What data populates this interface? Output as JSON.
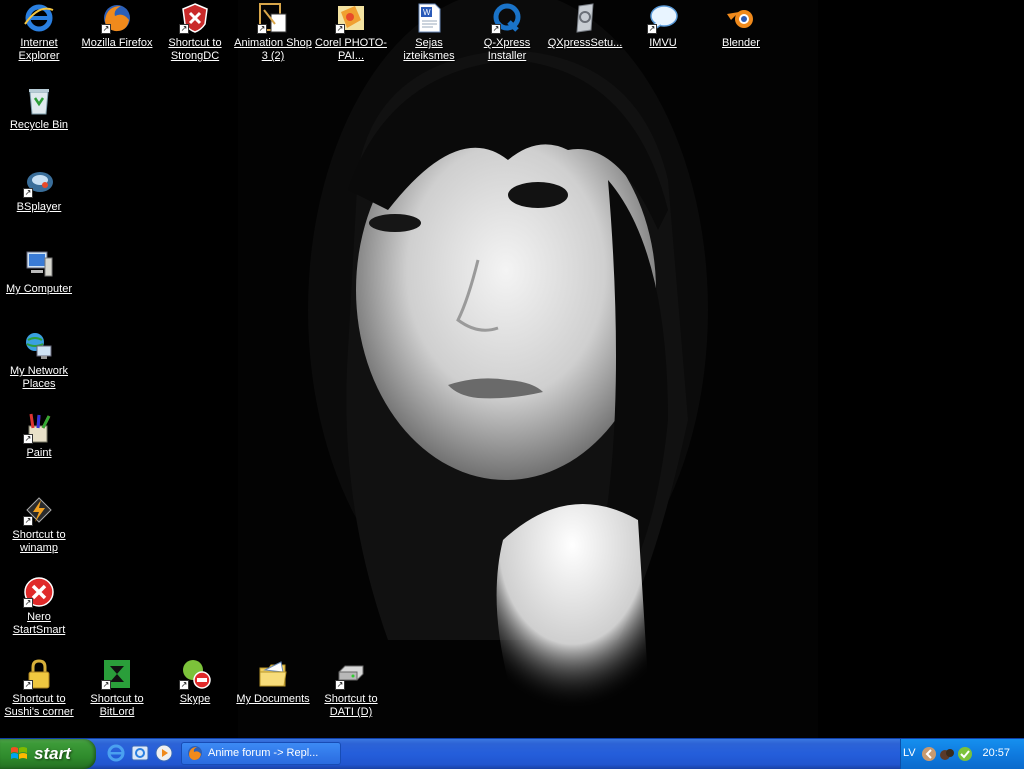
{
  "desktop": {
    "icons": [
      {
        "label": "Internet Explorer",
        "icon": "internet-explorer-icon"
      },
      {
        "label": "Mozilla Firefox",
        "icon": "firefox-icon"
      },
      {
        "label": "Shortcut to StrongDC",
        "icon": "strongdc-icon"
      },
      {
        "label": "Animation Shop 3 (2)",
        "icon": "animation-shop-icon"
      },
      {
        "label": "Corel PHOTO-PAI...",
        "icon": "corel-photo-paint-icon"
      },
      {
        "label": "Sejas izteiksmes",
        "icon": "word-document-icon"
      },
      {
        "label": "Q-Xpress Installer",
        "icon": "qxpress-installer-icon"
      },
      {
        "label": "QXpressSetu...",
        "icon": "qxpress-setup-icon"
      },
      {
        "label": "IMVU",
        "icon": "imvu-icon"
      },
      {
        "label": "Blender",
        "icon": "blender-icon"
      },
      {
        "label": "Recycle Bin",
        "icon": "recycle-bin-icon"
      },
      {
        "label": "BSplayer",
        "icon": "bsplayer-icon"
      },
      {
        "label": "My Computer",
        "icon": "my-computer-icon"
      },
      {
        "label": "My Network Places",
        "icon": "network-places-icon"
      },
      {
        "label": "Paint",
        "icon": "paint-icon"
      },
      {
        "label": "Shortcut to winamp",
        "icon": "winamp-icon"
      },
      {
        "label": "Nero StartSmart",
        "icon": "nero-icon"
      },
      {
        "label": "Shortcut to Sushi's corner",
        "icon": "padlock-icon"
      },
      {
        "label": "Shortcut to BitLord",
        "icon": "bitlord-icon"
      },
      {
        "label": "Skype",
        "icon": "skype-icon"
      },
      {
        "label": "My Documents",
        "icon": "my-documents-icon"
      },
      {
        "label": "Shortcut to DATI (D)",
        "icon": "drive-icon"
      }
    ]
  },
  "taskbar": {
    "start_label": "start",
    "quick_launch": [
      "internet-explorer-icon",
      "browser-icon",
      "media-player-icon"
    ],
    "task_title": "Anime forum -> Repl...",
    "language": "LV",
    "clock": "20:57"
  },
  "colors": {
    "taskbar": "#245edb",
    "start": "#2f8b2c",
    "tray": "#0f7be0"
  }
}
